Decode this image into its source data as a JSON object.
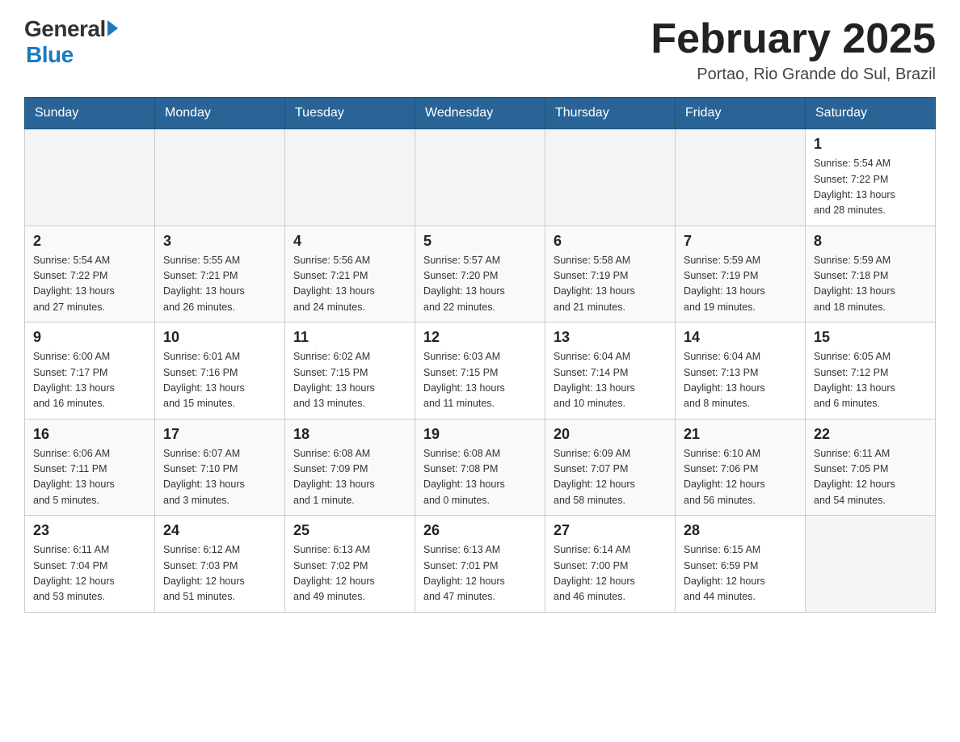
{
  "header": {
    "logo_general": "General",
    "logo_blue": "Blue",
    "month_title": "February 2025",
    "location": "Portao, Rio Grande do Sul, Brazil"
  },
  "weekdays": [
    "Sunday",
    "Monday",
    "Tuesday",
    "Wednesday",
    "Thursday",
    "Friday",
    "Saturday"
  ],
  "weeks": [
    {
      "days": [
        {
          "number": "",
          "info": ""
        },
        {
          "number": "",
          "info": ""
        },
        {
          "number": "",
          "info": ""
        },
        {
          "number": "",
          "info": ""
        },
        {
          "number": "",
          "info": ""
        },
        {
          "number": "",
          "info": ""
        },
        {
          "number": "1",
          "info": "Sunrise: 5:54 AM\nSunset: 7:22 PM\nDaylight: 13 hours\nand 28 minutes."
        }
      ]
    },
    {
      "days": [
        {
          "number": "2",
          "info": "Sunrise: 5:54 AM\nSunset: 7:22 PM\nDaylight: 13 hours\nand 27 minutes."
        },
        {
          "number": "3",
          "info": "Sunrise: 5:55 AM\nSunset: 7:21 PM\nDaylight: 13 hours\nand 26 minutes."
        },
        {
          "number": "4",
          "info": "Sunrise: 5:56 AM\nSunset: 7:21 PM\nDaylight: 13 hours\nand 24 minutes."
        },
        {
          "number": "5",
          "info": "Sunrise: 5:57 AM\nSunset: 7:20 PM\nDaylight: 13 hours\nand 22 minutes."
        },
        {
          "number": "6",
          "info": "Sunrise: 5:58 AM\nSunset: 7:19 PM\nDaylight: 13 hours\nand 21 minutes."
        },
        {
          "number": "7",
          "info": "Sunrise: 5:59 AM\nSunset: 7:19 PM\nDaylight: 13 hours\nand 19 minutes."
        },
        {
          "number": "8",
          "info": "Sunrise: 5:59 AM\nSunset: 7:18 PM\nDaylight: 13 hours\nand 18 minutes."
        }
      ]
    },
    {
      "days": [
        {
          "number": "9",
          "info": "Sunrise: 6:00 AM\nSunset: 7:17 PM\nDaylight: 13 hours\nand 16 minutes."
        },
        {
          "number": "10",
          "info": "Sunrise: 6:01 AM\nSunset: 7:16 PM\nDaylight: 13 hours\nand 15 minutes."
        },
        {
          "number": "11",
          "info": "Sunrise: 6:02 AM\nSunset: 7:15 PM\nDaylight: 13 hours\nand 13 minutes."
        },
        {
          "number": "12",
          "info": "Sunrise: 6:03 AM\nSunset: 7:15 PM\nDaylight: 13 hours\nand 11 minutes."
        },
        {
          "number": "13",
          "info": "Sunrise: 6:04 AM\nSunset: 7:14 PM\nDaylight: 13 hours\nand 10 minutes."
        },
        {
          "number": "14",
          "info": "Sunrise: 6:04 AM\nSunset: 7:13 PM\nDaylight: 13 hours\nand 8 minutes."
        },
        {
          "number": "15",
          "info": "Sunrise: 6:05 AM\nSunset: 7:12 PM\nDaylight: 13 hours\nand 6 minutes."
        }
      ]
    },
    {
      "days": [
        {
          "number": "16",
          "info": "Sunrise: 6:06 AM\nSunset: 7:11 PM\nDaylight: 13 hours\nand 5 minutes."
        },
        {
          "number": "17",
          "info": "Sunrise: 6:07 AM\nSunset: 7:10 PM\nDaylight: 13 hours\nand 3 minutes."
        },
        {
          "number": "18",
          "info": "Sunrise: 6:08 AM\nSunset: 7:09 PM\nDaylight: 13 hours\nand 1 minute."
        },
        {
          "number": "19",
          "info": "Sunrise: 6:08 AM\nSunset: 7:08 PM\nDaylight: 13 hours\nand 0 minutes."
        },
        {
          "number": "20",
          "info": "Sunrise: 6:09 AM\nSunset: 7:07 PM\nDaylight: 12 hours\nand 58 minutes."
        },
        {
          "number": "21",
          "info": "Sunrise: 6:10 AM\nSunset: 7:06 PM\nDaylight: 12 hours\nand 56 minutes."
        },
        {
          "number": "22",
          "info": "Sunrise: 6:11 AM\nSunset: 7:05 PM\nDaylight: 12 hours\nand 54 minutes."
        }
      ]
    },
    {
      "days": [
        {
          "number": "23",
          "info": "Sunrise: 6:11 AM\nSunset: 7:04 PM\nDaylight: 12 hours\nand 53 minutes."
        },
        {
          "number": "24",
          "info": "Sunrise: 6:12 AM\nSunset: 7:03 PM\nDaylight: 12 hours\nand 51 minutes."
        },
        {
          "number": "25",
          "info": "Sunrise: 6:13 AM\nSunset: 7:02 PM\nDaylight: 12 hours\nand 49 minutes."
        },
        {
          "number": "26",
          "info": "Sunrise: 6:13 AM\nSunset: 7:01 PM\nDaylight: 12 hours\nand 47 minutes."
        },
        {
          "number": "27",
          "info": "Sunrise: 6:14 AM\nSunset: 7:00 PM\nDaylight: 12 hours\nand 46 minutes."
        },
        {
          "number": "28",
          "info": "Sunrise: 6:15 AM\nSunset: 6:59 PM\nDaylight: 12 hours\nand 44 minutes."
        },
        {
          "number": "",
          "info": ""
        }
      ]
    }
  ]
}
